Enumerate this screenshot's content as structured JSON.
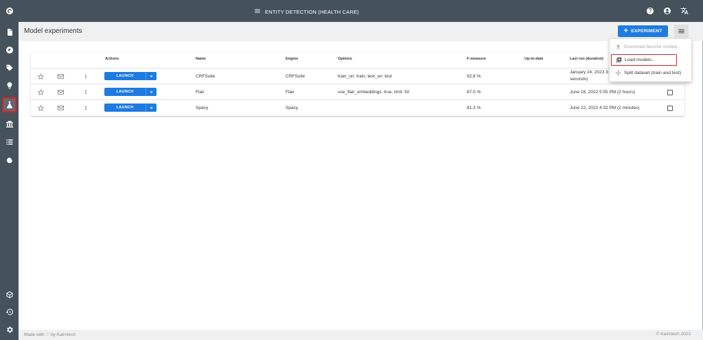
{
  "app": {
    "title": "ENTITY DETECTION (HEALTH CARE)"
  },
  "header": {
    "page_title": "Model experiments",
    "experiment_button": "EXPERIMENT",
    "experiment_plus": "+"
  },
  "table": {
    "columns": [
      "Actions",
      "Name",
      "Engine",
      "Options",
      "F-measure",
      "Up-to-date",
      "Last run (duration)"
    ],
    "launch_label": "LAUNCH",
    "rows": [
      {
        "name": "CRFSuite",
        "engine": "CRFSuite",
        "options": "train_on: train, test_on: test",
        "fmeasure": "92.8 %",
        "last_run": "January 24, 2023 3:",
        "last_run_2": "seconds)"
      },
      {
        "name": "Flair",
        "engine": "Flair",
        "options": "use_flair_embeddings: true, limit: 50",
        "fmeasure": "87.0 %",
        "last_run": "June 16, 2022 5:55 PM (2 hours)",
        "last_run_2": ""
      },
      {
        "name": "Spacy",
        "engine": "Spacy",
        "options": "",
        "fmeasure": "81.3 %",
        "last_run": "June 22, 2022 4:32 PM (2 minutes)",
        "last_run_2": ""
      }
    ]
  },
  "menu": {
    "items": [
      {
        "label": "Download favorite models",
        "icon": "download-icon",
        "disabled": true
      },
      {
        "label": "Load models...",
        "icon": "load-models-icon",
        "disabled": false
      },
      {
        "label": "Split dataset (train and test)",
        "icon": "split-icon",
        "disabled": false
      }
    ]
  },
  "footer": {
    "left": "Made with ♡ by Kairntech",
    "right": "©   Kairntech 2023"
  },
  "colors": {
    "sidebar": "#45525c",
    "accent": "#1e7be0",
    "highlight": "#e02020"
  }
}
